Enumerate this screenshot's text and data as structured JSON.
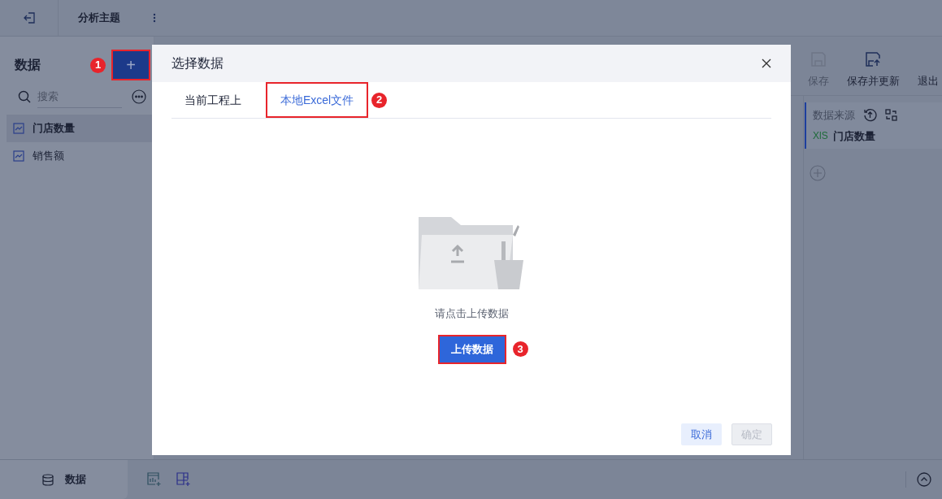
{
  "top_bar": {
    "title": "分析主题"
  },
  "sidebar": {
    "title": "数据",
    "add_button": {
      "label": "+",
      "highlighted": true,
      "marker": "1"
    },
    "search": {
      "placeholder": "搜索"
    },
    "items": [
      {
        "label": "门店数量",
        "selected": true
      },
      {
        "label": "销售额",
        "selected": false
      }
    ]
  },
  "toolbar": [
    {
      "label": "保存",
      "disabled": true,
      "kind": "save"
    },
    {
      "label": "保存并更新",
      "disabled": false,
      "kind": "update"
    },
    {
      "label": "退出",
      "disabled": false,
      "kind": "exit"
    }
  ],
  "right_panel": {
    "title": "数据来源",
    "source": {
      "badge": "XlS",
      "name": "门店数量"
    }
  },
  "bottom_bar": {
    "tab": "数据"
  },
  "dialog": {
    "title": "选择数据",
    "tabs": [
      {
        "label": "当前工程上",
        "selected": false,
        "highlighted": false
      },
      {
        "label": "本地Excel文件",
        "selected": true,
        "highlighted": true,
        "marker": "2"
      }
    ],
    "hint": "请点击上传数据",
    "upload_button": {
      "label": "上传数据",
      "highlighted": true,
      "marker": "3"
    },
    "buttons": [
      {
        "label": "取消",
        "disabled": false
      },
      {
        "label": "确定",
        "disabled": true
      }
    ]
  }
}
